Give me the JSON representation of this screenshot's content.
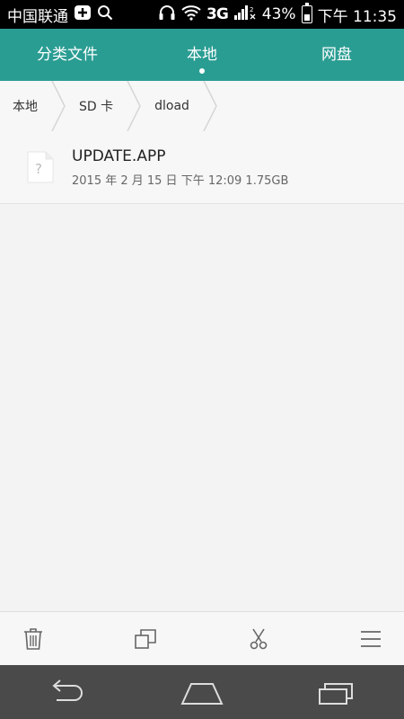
{
  "status_bar": {
    "carrier": "中国联通",
    "network": "3G",
    "battery": "43%",
    "time": "下午 11:35",
    "icons": [
      "plus-box-icon",
      "search-icon",
      "headphones-icon",
      "wifi-icon",
      "signal-icon",
      "battery-icon"
    ]
  },
  "header": {
    "tabs": [
      {
        "label": "分类文件"
      },
      {
        "label": "本地",
        "active": true
      },
      {
        "label": "网盘"
      }
    ],
    "bg_color": "#2a9d93"
  },
  "breadcrumb": {
    "items": [
      {
        "label": "本地"
      },
      {
        "label": "SD 卡"
      },
      {
        "label": "dload"
      }
    ]
  },
  "files": [
    {
      "name": "UPDATE.APP",
      "info": "2015 年 2 月 15 日 下午 12:09 1.75GB",
      "icon": "unknown-file-icon"
    }
  ],
  "toolbar": {
    "icons": [
      "trash-icon",
      "copy-icon",
      "cut-icon",
      "menu-icon"
    ]
  },
  "navbar": {
    "icons": [
      "back-icon",
      "home-icon",
      "recent-apps-icon"
    ]
  }
}
